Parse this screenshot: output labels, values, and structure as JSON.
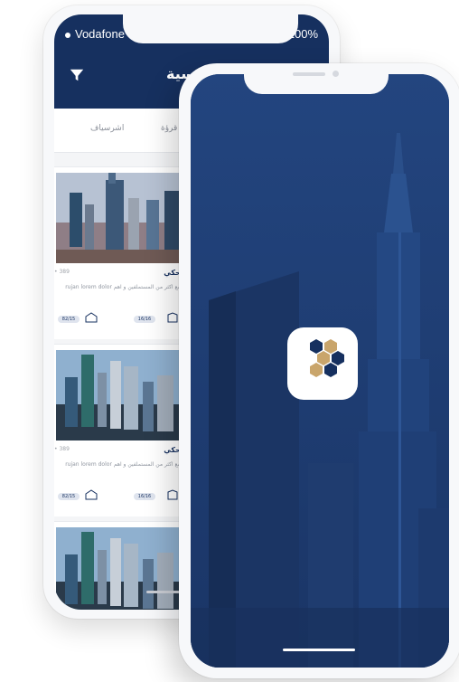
{
  "back_phone": {
    "status": {
      "carrier": "Vodafone",
      "battery": "100%"
    },
    "header_title": "رئيسية",
    "tabs": [
      "اشرسياف",
      "قرؤة"
    ],
    "cards": [
      {
        "meta": "• 389",
        "title": "ناطقة برج احكي",
        "description": "مزعار احكى في جمع اكثر من المستملفين و اهم rujan lorem dolor sit amet",
        "pill_a": "82/15",
        "pill_b": "16/16"
      },
      {
        "meta": "• 389",
        "title": "ناطقة برج احكي",
        "description": "مزعار احكى في جمع اكثر من المستملفين و اهم rujan lorem dolor sit amet",
        "pill_a": "82/15",
        "pill_b": "16/16"
      }
    ]
  },
  "front_phone": {
    "screen": "splash",
    "logo": "hexagon-logo-icon"
  },
  "colors": {
    "brand_navy": "#16305f",
    "gold": "#c9a56b",
    "splash_blue": "#1c3b73"
  }
}
